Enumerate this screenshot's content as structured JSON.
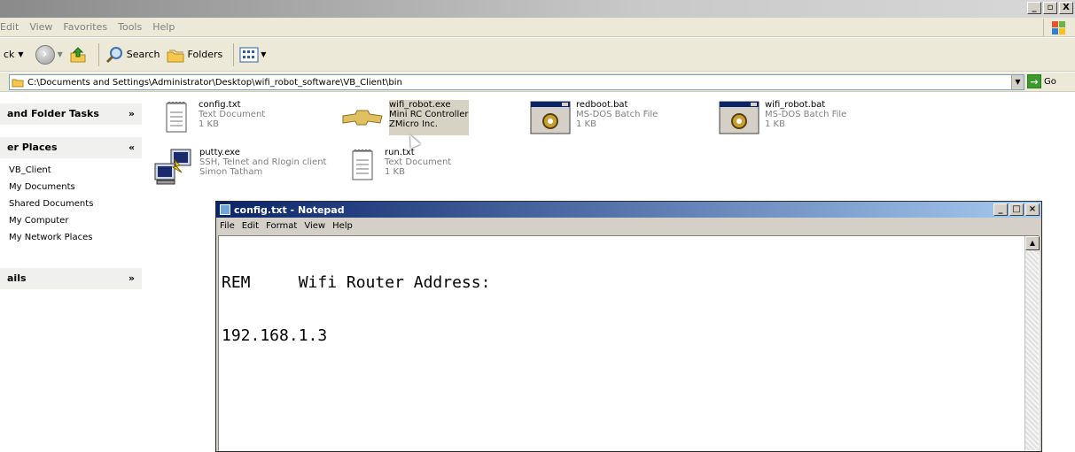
{
  "window": {
    "buttons": [
      "_",
      "▫",
      "X"
    ]
  },
  "menubar": {
    "items": [
      "Edit",
      "View",
      "Favorites",
      "Tools",
      "Help"
    ]
  },
  "toolbar": {
    "back_label": "ck",
    "search_label": "Search",
    "folders_label": "Folders"
  },
  "address": {
    "path": "C:\\Documents and Settings\\Administrator\\Desktop\\wifi_robot_software\\VB_Client\\bin",
    "go_label": "Go"
  },
  "leftpane": {
    "tasks_header": "and Folder Tasks",
    "places_header": "er Places",
    "places": [
      "VB_Client",
      "My Documents",
      "Shared Documents",
      "My Computer",
      "My Network Places"
    ],
    "details_header": "ails"
  },
  "files": [
    {
      "name": "config.txt",
      "type": "Text Document",
      "info": "1 KB",
      "icon": "notepad-file-icon"
    },
    {
      "name": "wifi_robot.exe",
      "type": "Mini RC Controller",
      "info": "ZMicro Inc.",
      "icon": "chevrolet-logo-icon"
    },
    {
      "name": "redboot.bat",
      "type": "MS-DOS Batch File",
      "info": "1 KB",
      "icon": "batch-gear-icon"
    },
    {
      "name": "wifi_robot.bat",
      "type": "MS-DOS Batch File",
      "info": "1 KB",
      "icon": "batch-gear-icon"
    },
    {
      "name": "putty.exe",
      "type": "SSH, Telnet and Rlogin client",
      "info": "Simon Tatham",
      "icon": "putty-icon"
    },
    {
      "name": "run.txt",
      "type": "Text Document",
      "info": "1 KB",
      "icon": "notepad-file-icon"
    }
  ],
  "notepad": {
    "title": "config.txt - Notepad",
    "menu": [
      "File",
      "Edit",
      "Format",
      "View",
      "Help"
    ],
    "content_line1": "REM     Wifi Router Address:",
    "content_line2": "192.168.1.3"
  },
  "colors": {
    "titlebar_active": "#0a246a",
    "go_green": "#3a9b2c"
  }
}
